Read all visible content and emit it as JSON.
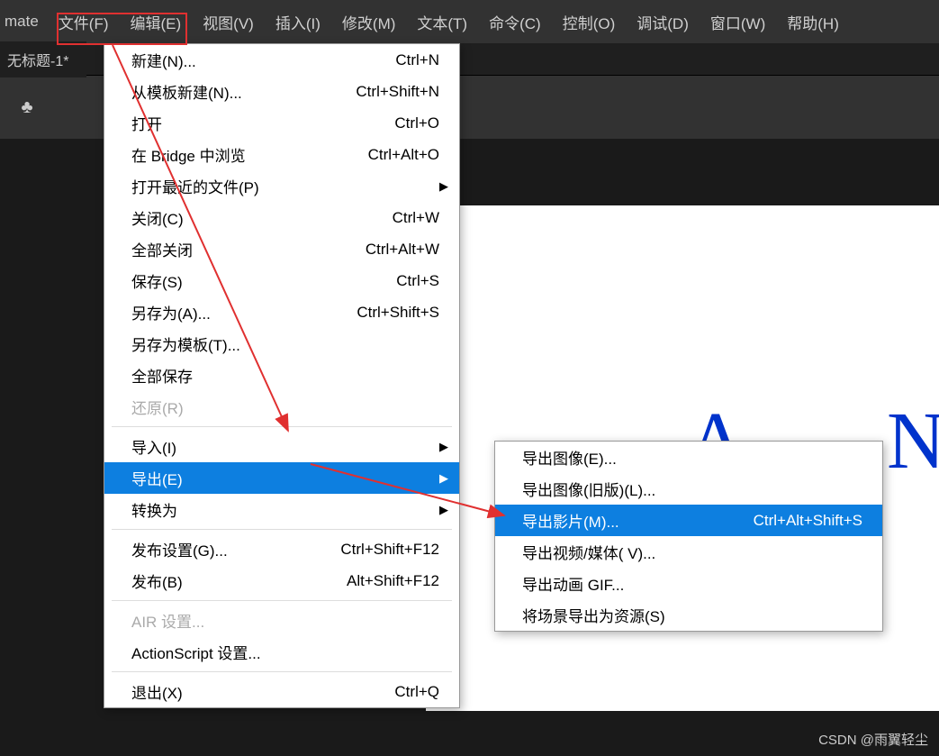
{
  "app": {
    "name_fragment": "mate"
  },
  "menubar": {
    "items": [
      {
        "label": "文件(F)"
      },
      {
        "label": "编辑(E)"
      },
      {
        "label": "视图(V)"
      },
      {
        "label": "插入(I)"
      },
      {
        "label": "修改(M)"
      },
      {
        "label": "文本(T)"
      },
      {
        "label": "命令(C)"
      },
      {
        "label": "控制(O)"
      },
      {
        "label": "调试(D)"
      },
      {
        "label": "窗口(W)"
      },
      {
        "label": "帮助(H)"
      }
    ]
  },
  "tab": {
    "label": "无标题-1*"
  },
  "toolbar": {
    "clubs_icon": "♣"
  },
  "file_menu": {
    "groups": [
      [
        {
          "label": "新建(N)...",
          "shortcut": "Ctrl+N"
        },
        {
          "label": "从模板新建(N)...",
          "shortcut": "Ctrl+Shift+N"
        },
        {
          "label": "打开",
          "shortcut": "Ctrl+O"
        },
        {
          "label": "在 Bridge 中浏览",
          "shortcut": "Ctrl+Alt+O"
        },
        {
          "label": "打开最近的文件(P)",
          "submenu": true
        },
        {
          "label": "关闭(C)",
          "shortcut": "Ctrl+W"
        },
        {
          "label": "全部关闭",
          "shortcut": "Ctrl+Alt+W"
        },
        {
          "label": "保存(S)",
          "shortcut": "Ctrl+S"
        },
        {
          "label": "另存为(A)...",
          "shortcut": "Ctrl+Shift+S"
        },
        {
          "label": "另存为模板(T)...",
          "shortcut": ""
        },
        {
          "label": "全部保存",
          "shortcut": ""
        },
        {
          "label": "还原(R)",
          "shortcut": "",
          "disabled": true
        }
      ],
      [
        {
          "label": "导入(I)",
          "submenu": true
        },
        {
          "label": "导出(E)",
          "submenu": true,
          "highlighted": true
        },
        {
          "label": "转换为",
          "submenu": true
        }
      ],
      [
        {
          "label": "发布设置(G)...",
          "shortcut": "Ctrl+Shift+F12"
        },
        {
          "label": "发布(B)",
          "shortcut": "Alt+Shift+F12"
        }
      ],
      [
        {
          "label": "AIR 设置...",
          "shortcut": "",
          "disabled": true
        },
        {
          "label": "ActionScript 设置...",
          "shortcut": ""
        }
      ],
      [
        {
          "label": "退出(X)",
          "shortcut": "Ctrl+Q"
        }
      ]
    ]
  },
  "export_submenu": {
    "items": [
      {
        "label": "导出图像(E)...",
        "shortcut": ""
      },
      {
        "label": "导出图像(旧版)(L)...",
        "shortcut": ""
      },
      {
        "label": "导出影片(M)...",
        "shortcut": "Ctrl+Alt+Shift+S",
        "highlighted": true
      },
      {
        "label": "导出视频/媒体( V)...",
        "shortcut": ""
      },
      {
        "label": "导出动画 GIF...",
        "shortcut": ""
      },
      {
        "label": "将场景导出为资源(S)",
        "shortcut": ""
      }
    ]
  },
  "canvas": {
    "letter_a": "A",
    "letter_n": "N"
  },
  "watermark": "CSDN @雨翼轻尘"
}
